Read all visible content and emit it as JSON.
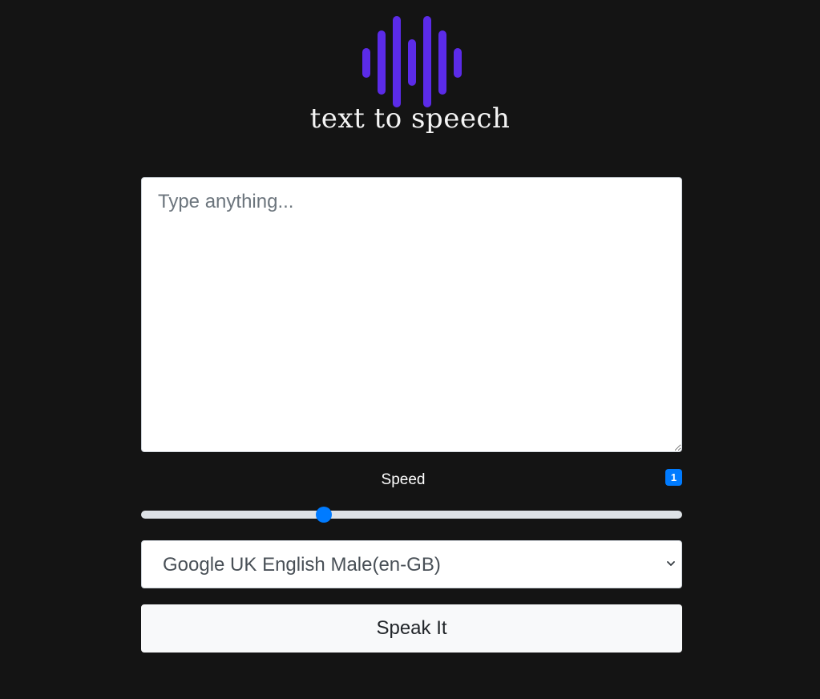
{
  "logo": {
    "icon": "sound-wave-icon",
    "text": "text to speech",
    "accent_color": "#5b2be8"
  },
  "text_input": {
    "value": "",
    "placeholder": "Type anything..."
  },
  "speed": {
    "label": "Speed",
    "badge": "1",
    "slider_fraction": 0.338,
    "accent_color": "#007bff"
  },
  "voice": {
    "selected": "Google UK English Male(en-GB)",
    "icon": "chevron-down-icon"
  },
  "speak_button": {
    "label": "Speak It"
  }
}
